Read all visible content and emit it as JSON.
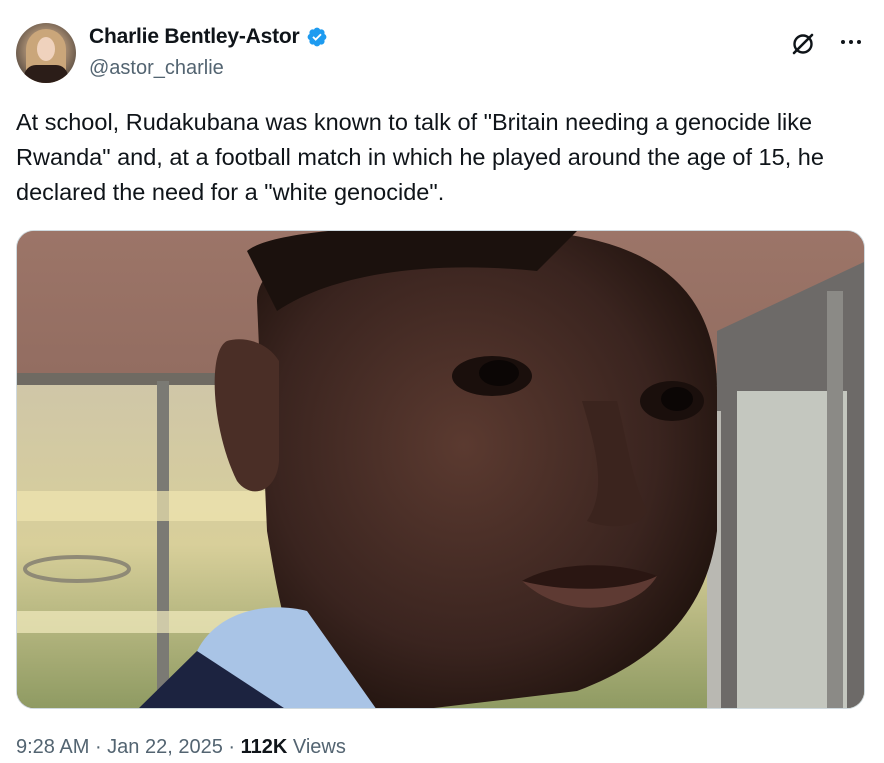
{
  "author": {
    "display_name": "Charlie Bentley-Astor",
    "handle": "@astor_charlie",
    "verified": true
  },
  "tweet": {
    "text": "At school, Rudakubana was known to talk of \"Britain needing a genocide like Rwanda\" and, at a football match in which he played around the age of 15, he declared the need for a \"white genocide\".",
    "time": "9:28 AM",
    "separator_1": " · ",
    "date": "Jan 22, 2025",
    "separator_2": " · ",
    "views_count": "112K",
    "views_label": " Views"
  },
  "icons": {
    "grok": "grok-icon",
    "more": "more-options-icon",
    "verified": "verified-badge-icon"
  },
  "colors": {
    "verified_blue": "#1d9bf0",
    "secondary_text": "#536471",
    "primary_text": "#0f1419"
  }
}
